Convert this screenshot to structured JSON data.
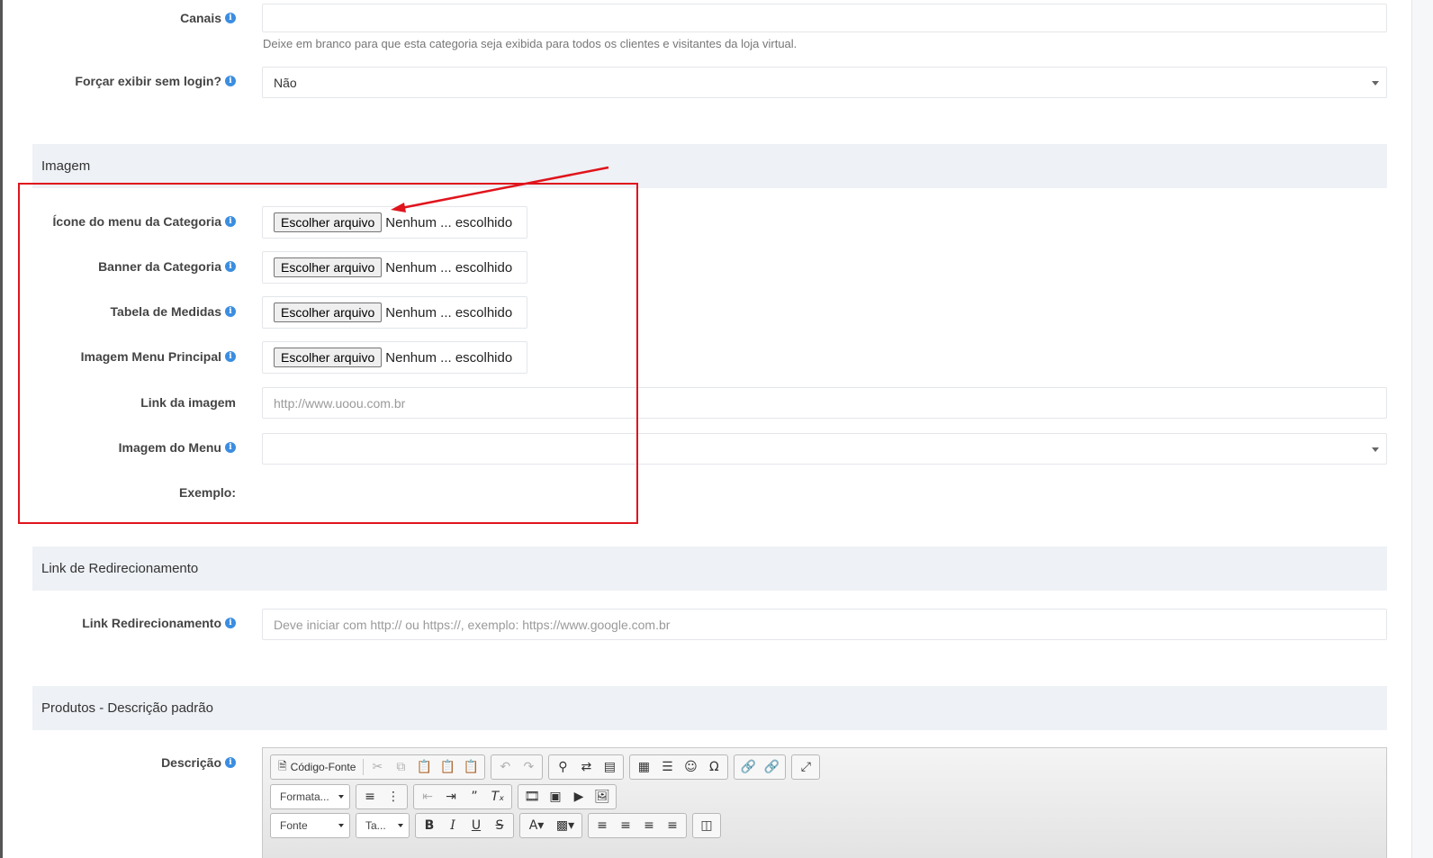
{
  "fields": {
    "canais": {
      "label": "Canais",
      "value": "",
      "help": "Deixe em branco para que esta categoria seja exibida para todos os clientes e visitantes da loja virtual."
    },
    "forcar_login": {
      "label": "Forçar exibir sem login?",
      "value": "Não"
    },
    "icone_menu": {
      "label": "Ícone do menu da Categoria"
    },
    "banner": {
      "label": "Banner da Categoria"
    },
    "tabela_medidas": {
      "label": "Tabela de Medidas"
    },
    "imagem_menu_principal": {
      "label": "Imagem Menu Principal"
    },
    "link_imagem": {
      "label": "Link da imagem",
      "placeholder": "http://www.uoou.com.br"
    },
    "imagem_menu": {
      "label": "Imagem do Menu",
      "value": ""
    },
    "exemplo": {
      "label": "Exemplo:"
    },
    "link_redirecionamento": {
      "label": "Link Redirecionamento",
      "placeholder": "Deve iniciar com http:// ou https://, exemplo: https://www.google.com.br"
    },
    "descricao": {
      "label": "Descrição"
    }
  },
  "file_input": {
    "button": "Escolher arquivo",
    "status": "Nenhum ... escolhido"
  },
  "sections": {
    "imagem": "Imagem",
    "link_redirecionamento": "Link de Redirecionamento",
    "produtos": "Produtos - Descrição padrão"
  },
  "info_icon": "i",
  "editor": {
    "source_label": "Código-Fonte",
    "format_label": "Formata...",
    "font_label": "Fonte",
    "size_label": "Ta...",
    "icons_row1": [
      "cut-icon",
      "copy-icon",
      "paste-icon",
      "paste-text-icon",
      "paste-word-icon",
      "undo-icon",
      "redo-icon",
      "find-icon",
      "replace-icon",
      "select-all-icon",
      "table-icon",
      "hr-icon",
      "smiley-icon",
      "special-char-icon",
      "link-icon",
      "unlink-icon",
      "maximize-icon"
    ],
    "icons_row2": [
      "numbered-list-icon",
      "bulleted-list-icon",
      "outdent-icon",
      "indent-icon",
      "blockquote-icon",
      "remove-format-icon",
      "flash-icon",
      "iframe-icon",
      "youtube-icon",
      "image-icon"
    ],
    "icons_row3": [
      "bold-icon",
      "italic-icon",
      "underline-icon",
      "strike-icon",
      "text-color-icon",
      "bg-color-icon",
      "align-left-icon",
      "align-center-icon",
      "align-right-icon",
      "justify-icon",
      "show-blocks-icon"
    ]
  },
  "colors": {
    "annotation": "#e0141c",
    "info": "#3b8de0",
    "section_bg": "#eef1f5"
  }
}
